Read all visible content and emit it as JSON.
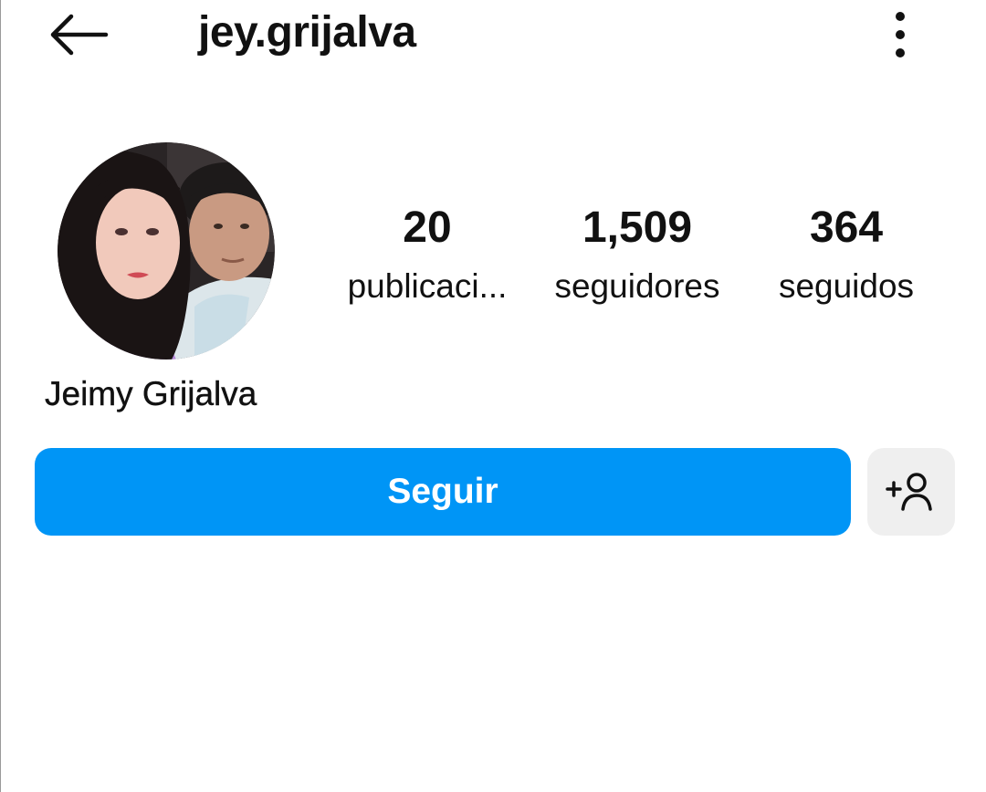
{
  "header": {
    "username": "jey.grijalva",
    "back_icon": "arrow-left-icon",
    "more_icon": "more-vertical-icon"
  },
  "profile": {
    "full_name": "Jeimy Grijalva",
    "avatar_icon": "profile-photo"
  },
  "stats": [
    {
      "count": "20",
      "label": "publicaci..."
    },
    {
      "count": "1,509",
      "label": "seguidores"
    },
    {
      "count": "364",
      "label": "seguidos"
    }
  ],
  "actions": {
    "follow_label": "Seguir",
    "follow_color": "#0095f6",
    "suggest_icon": "add-person-icon"
  }
}
